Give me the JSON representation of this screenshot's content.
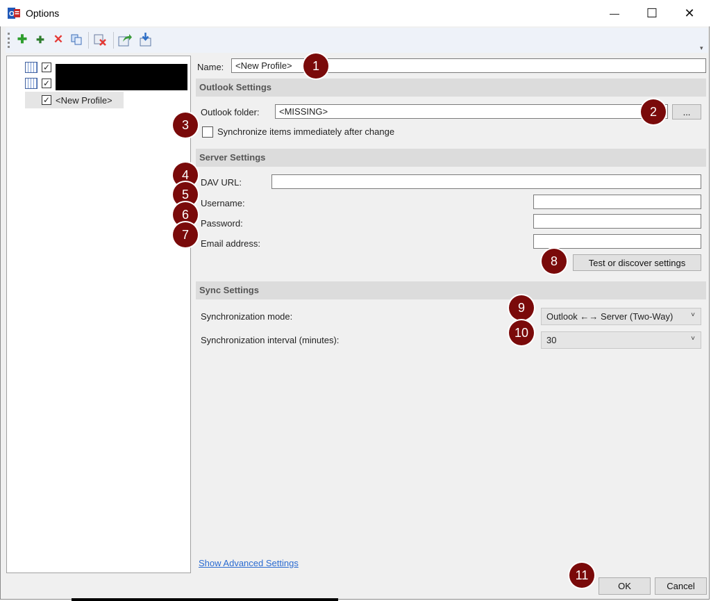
{
  "window": {
    "title": "Options",
    "minimize_glyph": "—",
    "maximize_glyph": "☐",
    "close_glyph": "✕"
  },
  "toolbar": {
    "icons": [
      "add-profile-icon",
      "add-multiple-profiles-icon",
      "delete-icon",
      "copy-icon",
      "clear-cache-icon",
      "export-icon",
      "import-icon"
    ]
  },
  "tree": {
    "items": [
      {
        "label": "",
        "checked": true,
        "icon": "calendar-icon",
        "redacted": true
      },
      {
        "label": "",
        "checked": true,
        "icon": "calendar-icon",
        "redacted": true
      },
      {
        "label": "<New Profile>",
        "checked": true,
        "selected": true
      }
    ],
    "check_glyph": "✓"
  },
  "form": {
    "name_label": "Name:",
    "name_value": "<New Profile>",
    "outlook_section": "Outlook Settings",
    "outlook_folder_label": "Outlook folder:",
    "outlook_folder_value": "<MISSING>",
    "browse_label": "...",
    "sync_immediately_label": "Synchronize items immediately after change",
    "server_section": "Server Settings",
    "dav_url_label": "DAV URL:",
    "dav_url_value": "",
    "username_label": "Username:",
    "username_value": "",
    "password_label": "Password:",
    "password_value": "",
    "email_label": "Email address:",
    "email_value": "",
    "test_button_label": "Test or discover settings",
    "sync_section": "Sync Settings",
    "sync_mode_label": "Synchronization mode:",
    "sync_mode_value": "Outlook ←→ Server (Two-Way)",
    "sync_interval_label": "Synchronization interval (minutes):",
    "sync_interval_value": "30",
    "show_advanced_label": "Show Advanced Settings"
  },
  "buttons": {
    "ok": "OK",
    "cancel": "Cancel"
  },
  "markers": [
    "1",
    "2",
    "3",
    "4",
    "5",
    "6",
    "7",
    "8",
    "9",
    "10",
    "11"
  ],
  "colors": {
    "marker": "#7a0a0a",
    "link": "#2a6bd1",
    "section": "#dcdcdc"
  }
}
